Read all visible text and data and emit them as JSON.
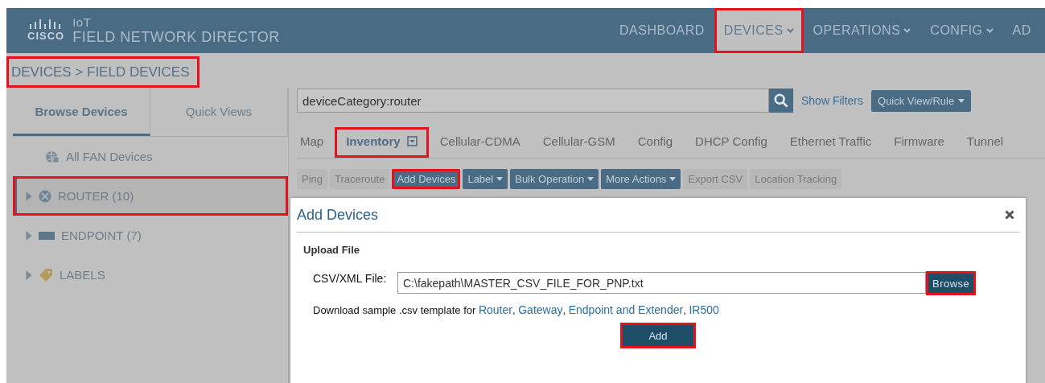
{
  "header": {
    "brand": "CISCO",
    "product_top": "IoT",
    "product_name": "FIELD NETWORK DIRECTOR",
    "nav": [
      {
        "label": "DASHBOARD",
        "selected": false,
        "dropdown": false,
        "highlighted": false
      },
      {
        "label": "DEVICES",
        "selected": true,
        "dropdown": true,
        "highlighted": true
      },
      {
        "label": "OPERATIONS",
        "selected": false,
        "dropdown": true,
        "highlighted": false
      },
      {
        "label": "CONFIG",
        "selected": false,
        "dropdown": true,
        "highlighted": false
      },
      {
        "label": "AD",
        "selected": false,
        "dropdown": false,
        "highlighted": false
      }
    ]
  },
  "breadcrumb": {
    "text": "DEVICES > FIELD DEVICES",
    "highlighted": true
  },
  "sidebar": {
    "tabs": [
      {
        "label": "Browse Devices",
        "selected": true
      },
      {
        "label": "Quick Views",
        "selected": false
      }
    ],
    "items": [
      {
        "label": "All FAN Devices",
        "kind": "globe",
        "expandable": false,
        "selected": false,
        "highlighted": false
      },
      {
        "label": "ROUTER (10)",
        "kind": "router",
        "expandable": true,
        "selected": true,
        "highlighted": true
      },
      {
        "label": "ENDPOINT (7)",
        "kind": "endpoint",
        "expandable": true,
        "selected": false,
        "highlighted": false
      },
      {
        "label": "LABELS",
        "kind": "tag",
        "expandable": true,
        "selected": false,
        "highlighted": false
      }
    ]
  },
  "search": {
    "value": "deviceCategory:router",
    "show_filters": "Show Filters",
    "quick_view": "Quick View/Rule"
  },
  "view_tabs": [
    {
      "label": "Map",
      "selected": false,
      "menu": false,
      "highlighted": false
    },
    {
      "label": "Inventory",
      "selected": true,
      "menu": true,
      "highlighted": true
    },
    {
      "label": "Cellular-CDMA",
      "selected": false,
      "menu": false,
      "highlighted": false
    },
    {
      "label": "Cellular-GSM",
      "selected": false,
      "menu": false,
      "highlighted": false
    },
    {
      "label": "Config",
      "selected": false,
      "menu": false,
      "highlighted": false
    },
    {
      "label": "DHCP Config",
      "selected": false,
      "menu": false,
      "highlighted": false
    },
    {
      "label": "Ethernet Traffic",
      "selected": false,
      "menu": false,
      "highlighted": false
    },
    {
      "label": "Firmware",
      "selected": false,
      "menu": false,
      "highlighted": false
    },
    {
      "label": "Tunnel",
      "selected": false,
      "menu": false,
      "highlighted": false
    }
  ],
  "toolbar": [
    {
      "label": "Ping",
      "disabled": true,
      "dropdown": false,
      "highlighted": false
    },
    {
      "label": "Traceroute",
      "disabled": true,
      "dropdown": false,
      "highlighted": false
    },
    {
      "label": "Add Devices",
      "disabled": false,
      "dropdown": false,
      "highlighted": true
    },
    {
      "label": "Label",
      "disabled": false,
      "dropdown": true,
      "highlighted": false
    },
    {
      "label": "Bulk Operation",
      "disabled": false,
      "dropdown": true,
      "highlighted": false
    },
    {
      "label": "More Actions",
      "disabled": false,
      "dropdown": true,
      "highlighted": false
    },
    {
      "label": "Export CSV",
      "disabled": true,
      "dropdown": false,
      "highlighted": false
    },
    {
      "label": "Location Tracking",
      "disabled": true,
      "dropdown": false,
      "highlighted": false
    }
  ],
  "dialog": {
    "title": "Add Devices",
    "section": "Upload File",
    "field_label": "CSV/XML File:",
    "file_value": "C:\\fakepath\\MASTER_CSV_FILE_FOR_PNP.txt",
    "browse": {
      "label": "Browse",
      "highlighted": true
    },
    "download_text": "Download sample .csv template for ",
    "links": [
      "Router",
      "Gateway",
      "Endpoint and Extender",
      "IR500"
    ],
    "link_separator": ",",
    "add": {
      "label": "Add",
      "highlighted": true
    }
  }
}
